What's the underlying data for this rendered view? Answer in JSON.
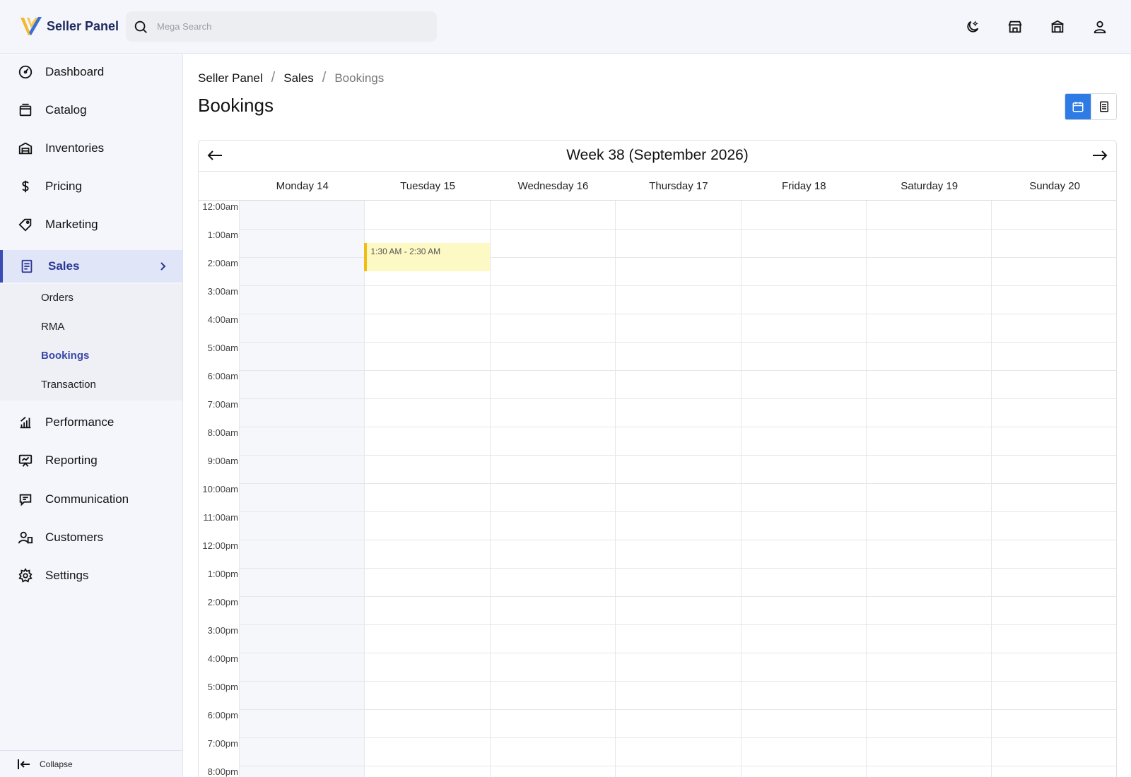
{
  "app": {
    "name": "Seller Panel"
  },
  "search": {
    "placeholder": "Mega Search"
  },
  "header_icons": [
    "dark-mode-icon",
    "store-icon",
    "shop-icon",
    "user-icon"
  ],
  "sidebar": {
    "items": [
      {
        "label": "Dashboard",
        "icon": "dashboard-icon"
      },
      {
        "label": "Catalog",
        "icon": "catalog-icon"
      },
      {
        "label": "Inventories",
        "icon": "inventories-icon"
      },
      {
        "label": "Pricing",
        "icon": "dollar-icon"
      },
      {
        "label": "Marketing",
        "icon": "tag-icon"
      },
      {
        "label": "Sales",
        "icon": "receipt-icon",
        "active": true
      },
      {
        "label": "Performance",
        "icon": "chart-icon"
      },
      {
        "label": "Reporting",
        "icon": "presentation-icon"
      },
      {
        "label": "Communication",
        "icon": "message-icon"
      },
      {
        "label": "Customers",
        "icon": "customers-icon"
      },
      {
        "label": "Settings",
        "icon": "gear-icon"
      }
    ],
    "sales_submenu": [
      {
        "label": "Orders"
      },
      {
        "label": "RMA"
      },
      {
        "label": "Bookings",
        "active": true
      },
      {
        "label": "Transaction"
      }
    ],
    "collapse_label": "Collapse"
  },
  "breadcrumb": [
    "Seller Panel",
    "Sales",
    "Bookings"
  ],
  "page": {
    "title": "Bookings",
    "view": "calendar"
  },
  "calendar": {
    "title": "Week 38 (September 2026)",
    "days": [
      "Monday 14",
      "Tuesday 15",
      "Wednesday 16",
      "Thursday 17",
      "Friday 18",
      "Saturday 19",
      "Sunday 20"
    ],
    "times": [
      "12:00am",
      "1:00am",
      "2:00am",
      "3:00am",
      "4:00am",
      "5:00am",
      "6:00am",
      "7:00am",
      "8:00am",
      "9:00am",
      "10:00am",
      "11:00am",
      "12:00pm",
      "1:00pm",
      "2:00pm",
      "3:00pm",
      "4:00pm",
      "5:00pm",
      "6:00pm",
      "7:00pm",
      "8:00pm"
    ],
    "events": [
      {
        "label": "1:30 AM - 2:30 AM",
        "day": "Tuesday 15",
        "start": "1:30 AM",
        "end": "2:30 AM"
      }
    ]
  },
  "colors": {
    "accent": "#3b4db5",
    "toggle_active": "#2e7be5",
    "event_bg": "#fdf9c4",
    "event_border": "#f0bd16"
  }
}
